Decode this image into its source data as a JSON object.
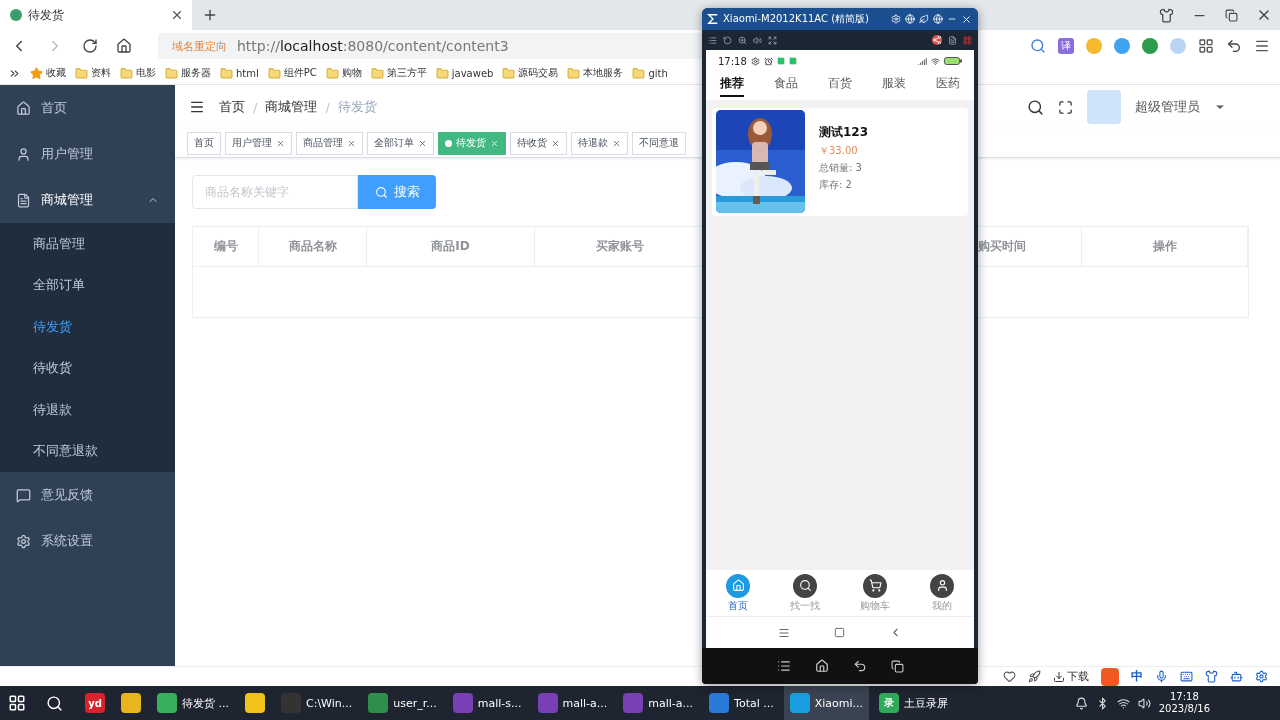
{
  "browser": {
    "tab_title": "待发货",
    "address_tag": "域名重定向",
    "url": "http://**localhost**:8080/content/content3",
    "translate_badge": "译",
    "bookmarks": [
      {
        "label": "收藏",
        "kind": "star"
      },
      {
        "label": "资料",
        "kind": "folder"
      },
      {
        "label": "电影",
        "kind": "folder"
      },
      {
        "label": "服务器",
        "kind": "folder"
      },
      {
        "label": "html",
        "kind": "folder"
      },
      {
        "label": "组件PC",
        "kind": "folder"
      },
      {
        "label": "购物",
        "kind": "folder"
      },
      {
        "label": "第三方平",
        "kind": "folder"
      },
      {
        "label": "javaweb",
        "kind": "folder"
      },
      {
        "label": "源码交易",
        "kind": "folder"
      },
      {
        "label": "本地服务",
        "kind": "folder"
      },
      {
        "label": "gith",
        "kind": "folder"
      }
    ]
  },
  "sidebar": {
    "items": [
      {
        "label": "首页",
        "selected": false
      },
      {
        "label": "用户管理",
        "selected": false
      },
      {
        "label": "商城管理",
        "selected": false,
        "expanded": true,
        "children": [
          {
            "label": "商品管理",
            "selected": false
          },
          {
            "label": "全部订单",
            "selected": false
          },
          {
            "label": "待发货",
            "selected": true
          },
          {
            "label": "待收货",
            "selected": false
          },
          {
            "label": "待退款",
            "selected": false
          },
          {
            "label": "不同意退款",
            "selected": false
          }
        ]
      },
      {
        "label": "意见反馈",
        "selected": false
      },
      {
        "label": "系统设置",
        "selected": false
      }
    ]
  },
  "header": {
    "breadcrumb": [
      {
        "kind": "link",
        "label": "首页"
      },
      {
        "kind": "separator",
        "label": "/"
      },
      {
        "kind": "link",
        "label": "商城管理"
      },
      {
        "kind": "separator",
        "label": "/"
      },
      {
        "kind": "current",
        "label": "待发货"
      }
    ],
    "user": "超级管理员"
  },
  "tags": [
    {
      "label": "首页",
      "selected": false,
      "closable": false
    },
    {
      "label": "用户管理",
      "selected": false,
      "closable": true
    },
    {
      "label": "商品管理",
      "selected": false,
      "closable": true
    },
    {
      "label": "全部订单",
      "selected": false,
      "closable": true
    },
    {
      "label": "待发货",
      "selected": true,
      "closable": true
    },
    {
      "label": "待收货",
      "selected": false,
      "closable": true
    },
    {
      "label": "待退款",
      "selected": false,
      "closable": true
    },
    {
      "label": "不同意退",
      "selected": false,
      "closable": false
    }
  ],
  "search": {
    "placeholder": "商品名称关键字",
    "button": "搜索"
  },
  "table": {
    "columns": [
      "编号",
      "商品名称",
      "商品ID",
      "买家账号",
      "购买时间",
      "操作"
    ]
  },
  "status_bar": {
    "download": "下载",
    "ime": "中"
  },
  "phone": {
    "window_title": "Xiaomi-M2012K11AC (精简版)",
    "time": "17:18",
    "tabs": [
      {
        "label": "推荐",
        "selected": true
      },
      {
        "label": "食品",
        "selected": false
      },
      {
        "label": "百货",
        "selected": false
      },
      {
        "label": "服装",
        "selected": false
      },
      {
        "label": "医药",
        "selected": false
      }
    ],
    "products": [
      {
        "kind": "picture",
        "name": "测试123",
        "price": "￥33.00",
        "sales": "总销量: 3",
        "stock": "库存: 2"
      }
    ],
    "nav": [
      {
        "label": "首页",
        "selected": true
      },
      {
        "label": "找一找",
        "selected": false
      },
      {
        "label": "购物车",
        "selected": false
      },
      {
        "label": "我的",
        "selected": false
      }
    ]
  },
  "taskbar": {
    "apps": [
      {
        "kind": "logo",
        "text": "yd",
        "selected": false
      },
      {
        "kind": "pinned",
        "selected": false
      },
      {
        "kind": "window",
        "label": "待发货 ...",
        "selected": false
      },
      {
        "kind": "pinned",
        "selected": false
      },
      {
        "kind": "window",
        "label": "C:\\Win...",
        "selected": false
      },
      {
        "kind": "window",
        "label": "user_r...",
        "selected": false
      },
      {
        "kind": "window",
        "label": "mall-s...",
        "selected": false
      },
      {
        "kind": "window",
        "label": "mall-a...",
        "selected": false
      },
      {
        "kind": "window",
        "label": "mall-a...",
        "selected": false
      },
      {
        "kind": "window",
        "label": "Total ...",
        "selected": false
      },
      {
        "kind": "window",
        "label": "Xiaomi...",
        "selected": true
      },
      {
        "kind": "window",
        "label": "土豆录屏",
        "badge": "录",
        "selected": false
      }
    ],
    "time": "17:18",
    "date": "2023/8/16"
  }
}
